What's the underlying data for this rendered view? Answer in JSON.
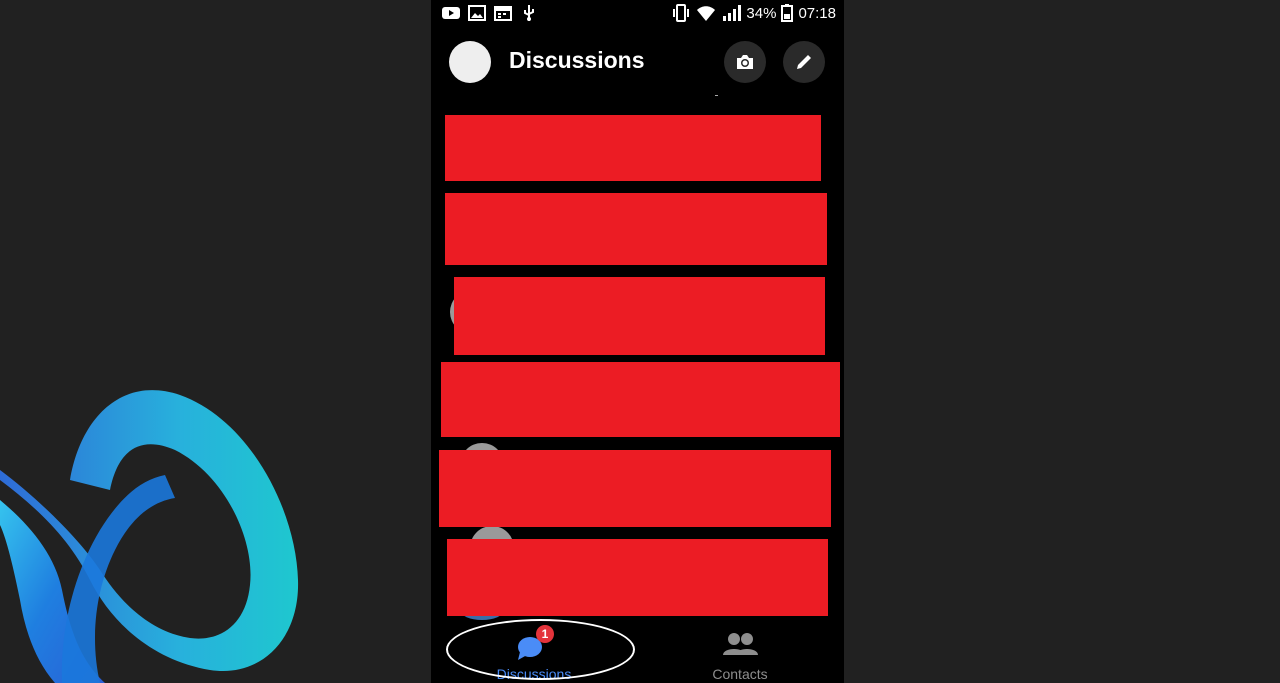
{
  "app": {
    "title": "Discussions",
    "accent_color": "#4a8cf7",
    "redaction_color": "#ec1c24"
  },
  "statusbar": {
    "left_icons": [
      "youtube-icon",
      "image-icon",
      "calendar-icon",
      "usb-icon"
    ],
    "battery": "34%",
    "time": "07:18",
    "right_icons": [
      "vibrate-icon",
      "wifi-icon",
      "signal-icon",
      "battery-icon"
    ]
  },
  "header": {
    "title": "Discussions",
    "buttons": [
      "camera-icon",
      "pencil-icon"
    ]
  },
  "conversations": {
    "count": 6,
    "state": "redacted"
  },
  "tabbar": {
    "tabs": [
      {
        "label": "Discussions",
        "badge": "1",
        "icon": "chat-bubble-icon",
        "active": true
      },
      {
        "label": "Contacts",
        "icon": "people-icon",
        "active": false
      }
    ]
  }
}
